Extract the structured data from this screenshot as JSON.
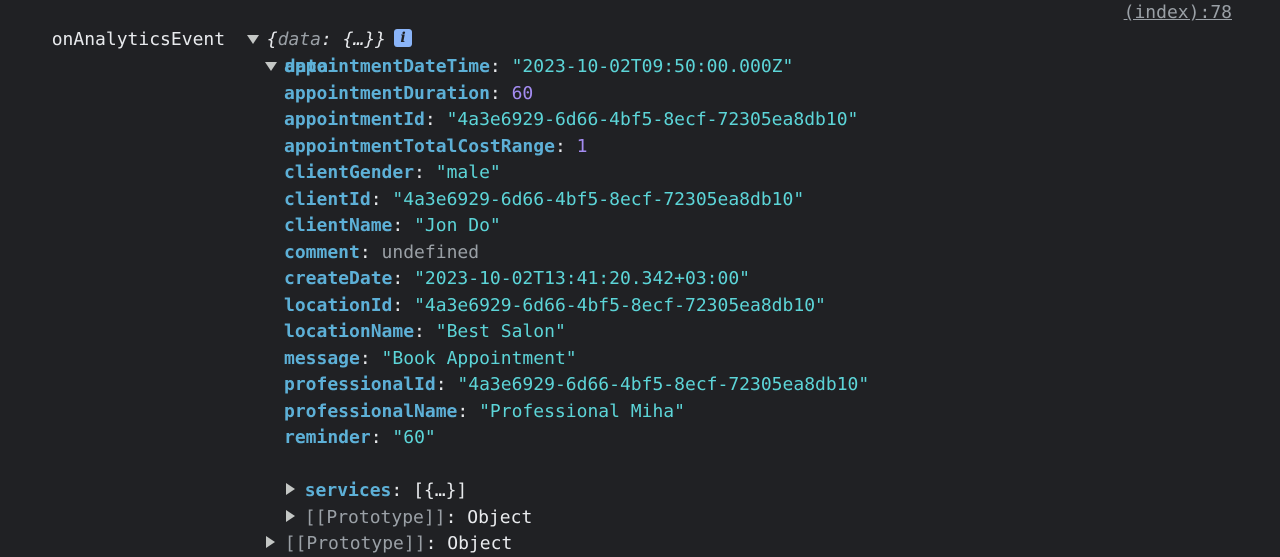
{
  "event": {
    "name": "onAnalyticsEvent",
    "summary_open": "{",
    "summary_key": "data",
    "summary_sep": ": ",
    "summary_value": "{…}",
    "summary_close": "}",
    "info_glyph": "i",
    "source": "(index):78"
  },
  "data_key": "data",
  "properties": [
    {
      "key": "appointmentDateTime",
      "value": "\"2023-10-02T09:50:00.000Z\"",
      "type": "string"
    },
    {
      "key": "appointmentDuration",
      "value": "60",
      "type": "number"
    },
    {
      "key": "appointmentId",
      "value": "\"4a3e6929-6d66-4bf5-8ecf-72305ea8db10\"",
      "type": "string"
    },
    {
      "key": "appointmentTotalCostRange",
      "value": "1",
      "type": "number"
    },
    {
      "key": "clientGender",
      "value": "\"male\"",
      "type": "string"
    },
    {
      "key": "clientId",
      "value": "\"4a3e6929-6d66-4bf5-8ecf-72305ea8db10\"",
      "type": "string"
    },
    {
      "key": "clientName",
      "value": "\"Jon Do\"",
      "type": "string"
    },
    {
      "key": "comment",
      "value": "undefined",
      "type": "undefined"
    },
    {
      "key": "createDate",
      "value": "\"2023-10-02T13:41:20.342+03:00\"",
      "type": "string"
    },
    {
      "key": "locationId",
      "value": "\"4a3e6929-6d66-4bf5-8ecf-72305ea8db10\"",
      "type": "string"
    },
    {
      "key": "locationName",
      "value": "\"Best Salon\"",
      "type": "string"
    },
    {
      "key": "message",
      "value": "\"Book Appointment\"",
      "type": "string"
    },
    {
      "key": "professionalId",
      "value": "\"4a3e6929-6d66-4bf5-8ecf-72305ea8db10\"",
      "type": "string"
    },
    {
      "key": "professionalName",
      "value": "\"Professional Miha\"",
      "type": "string"
    },
    {
      "key": "reminder",
      "value": "\"60\"",
      "type": "string"
    }
  ],
  "services": {
    "key": "services",
    "value": "[{…}]"
  },
  "inner_prototype": {
    "key": "[[Prototype]]",
    "value": "Object"
  },
  "outer_prototype": {
    "key": "[[Prototype]]",
    "value": "Object"
  }
}
